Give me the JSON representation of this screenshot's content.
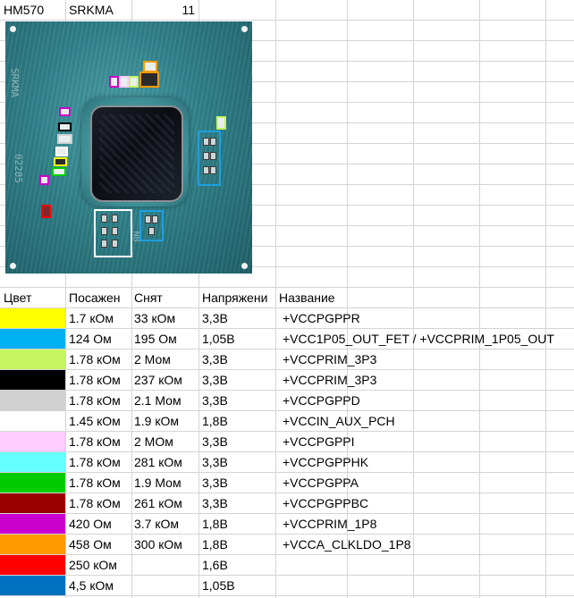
{
  "header": {
    "model": "HM570",
    "marking": "SRKMA",
    "count": "11"
  },
  "photo": {
    "alt": "Chip photo",
    "die_text": "SRKMA",
    "lot_text": "02285",
    "small_text": "NB"
  },
  "table": {
    "columns": [
      "Цвет",
      "Посажен",
      "Снят",
      "Напряжени",
      "Название"
    ],
    "rows": [
      {
        "color": "#ffff00",
        "installed": "1.7 кОм",
        "removed": "33 кОм",
        "voltage": "3,3В",
        "name": "+VCCPGPPR"
      },
      {
        "color": "#00b0f0",
        "installed": "124 Ом",
        "removed": "195 Ом",
        "voltage": "1,05В",
        "name": "+VCC1P05_OUT_FET / +VCCPRIM_1P05_OUT"
      },
      {
        "color": "#c5f560",
        "installed": "1.78 кОм",
        "removed": "2 Мом",
        "voltage": "3,3В",
        "name": "+VCCPRIM_3P3"
      },
      {
        "color": "#000000",
        "installed": "1.78 кОм",
        "removed": "237 кОм",
        "voltage": "3,3В",
        "name": "+VCCPRIM_3P3"
      },
      {
        "color": "#d0d0d0",
        "installed": "1.78 кОм",
        "removed": "2.1 Мом",
        "voltage": "3,3В",
        "name": "+VCCPGPPD"
      },
      {
        "color": "#ffffff",
        "installed": "1.45 кОм",
        "removed": "1.9 кОм",
        "voltage": "1,8В",
        "name": "+VCCIN_AUX_PCH"
      },
      {
        "color": "#ffccff",
        "installed": "1.78 кОм",
        "removed": "2 МОм",
        "voltage": "3,3В",
        "name": "+VCCPGPPI"
      },
      {
        "color": "#66ffff",
        "installed": "1.78 кОм",
        "removed": "281 кОм",
        "voltage": "3,3В",
        "name": "+VCCPGPPHK"
      },
      {
        "color": "#00cc00",
        "installed": "1.78 кОм",
        "removed": "1.9 Мом",
        "voltage": "3,3В",
        "name": "+VCCPGPPA"
      },
      {
        "color": "#990000",
        "installed": "1.78 кОм",
        "removed": "261 кОм",
        "voltage": "3,3В",
        "name": "+VCCPGPPBC"
      },
      {
        "color": "#cc00cc",
        "installed": "420 Ом",
        "removed": "3.7 кОм",
        "voltage": "1,8В",
        "name": "+VCCPRIM_1P8"
      },
      {
        "color": "#ff9900",
        "installed": "458 Ом",
        "removed": "300 кОм",
        "voltage": "1,8В",
        "name": "+VCCA_CLKLDO_1P8"
      },
      {
        "color": "#ff0000",
        "installed": "250 кОм",
        "removed": "",
        "voltage": "1,6В",
        "name": ""
      },
      {
        "color": "#0070c0",
        "installed": "4,5 кОм",
        "removed": "",
        "voltage": "1,05В",
        "name": ""
      }
    ]
  }
}
